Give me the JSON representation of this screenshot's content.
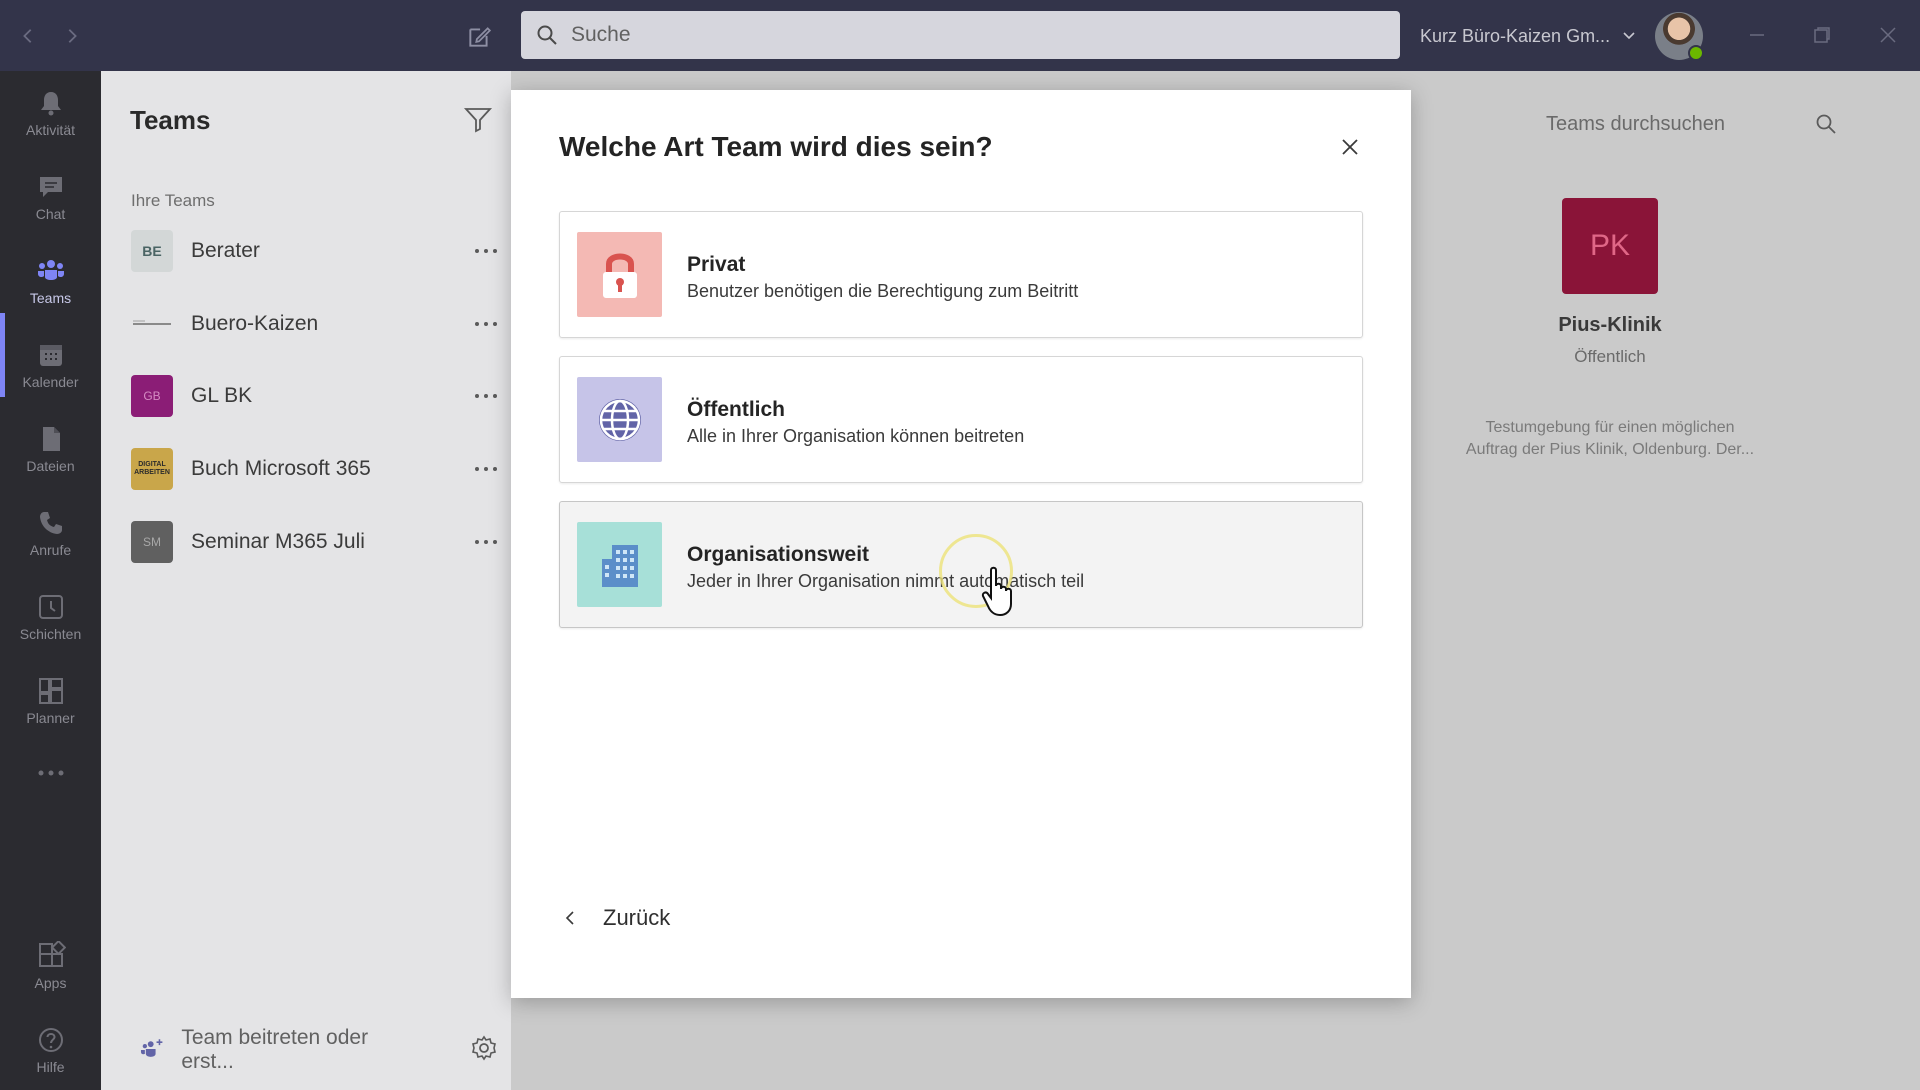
{
  "titlebar": {
    "search_placeholder": "Suche",
    "organization": "Kurz Büro-Kaizen Gm..."
  },
  "rail": {
    "items": [
      {
        "label": "Aktivität",
        "icon": "bell-icon"
      },
      {
        "label": "Chat",
        "icon": "chat-icon"
      },
      {
        "label": "Teams",
        "icon": "teams-icon"
      },
      {
        "label": "Kalender",
        "icon": "calendar-icon"
      },
      {
        "label": "Dateien",
        "icon": "files-icon"
      },
      {
        "label": "Anrufe",
        "icon": "phone-icon"
      },
      {
        "label": "Schichten",
        "icon": "clock-icon"
      },
      {
        "label": "Planner",
        "icon": "planner-icon"
      },
      {
        "label": "Apps",
        "icon": "apps-icon"
      },
      {
        "label": "Hilfe",
        "icon": "help-icon"
      }
    ],
    "active": "Teams"
  },
  "panel": {
    "title": "Teams",
    "section_label": "Ihre Teams",
    "teams": [
      {
        "initials": "BE",
        "name": "Berater",
        "color": "#d3d7d7",
        "text_color": "#4a6464"
      },
      {
        "initials": "",
        "name": "Buero-Kaizen",
        "color": "#e4e4e6",
        "text_color": "#6a6a6a"
      },
      {
        "initials": "GB",
        "name": "GL BK",
        "color": "#8b1d76",
        "text_color": "#d58cc3"
      },
      {
        "initials": "DIGITAL ARBEITEN",
        "name": "Buch Microsoft 365",
        "color": "#c9a64a",
        "text_color": "#2b2b2b"
      },
      {
        "initials": "SM",
        "name": "Seminar M365 Juli",
        "color": "#606060",
        "text_color": "#a8a8a8"
      }
    ],
    "join_label": "Team beitreten oder erst..."
  },
  "main": {
    "search_placeholder": "Teams durchsuchen",
    "card": {
      "initials": "PK",
      "name": "Pius-Klinik",
      "type": "Öffentlich",
      "description": "Testumgebung für einen möglichen Auftrag der Pius Klinik, Oldenburg. Der..."
    }
  },
  "modal": {
    "title": "Welche Art Team wird dies sein?",
    "options": [
      {
        "title": "Privat",
        "description": "Benutzer benötigen die Berechtigung zum Beitritt",
        "icon": "lock-icon",
        "icon_bg": "#f4b9b4"
      },
      {
        "title": "Öffentlich",
        "description": "Alle in Ihrer Organisation können beitreten",
        "icon": "globe-icon",
        "icon_bg": "#c6c4e8"
      },
      {
        "title": "Organisationsweit",
        "description": "Jeder in Ihrer Organisation nimmt automatisch teil",
        "icon": "building-icon",
        "icon_bg": "#a7e0d8"
      }
    ],
    "back_label": "Zurück"
  }
}
